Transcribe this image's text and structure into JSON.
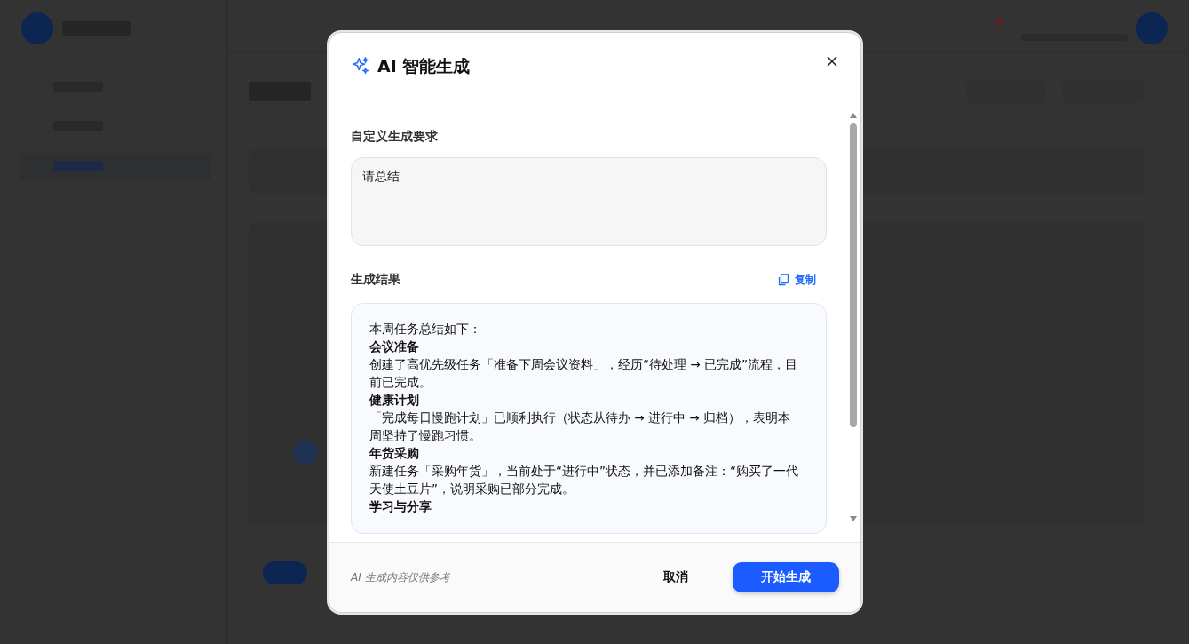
{
  "dialog": {
    "title": "AI 智能生成",
    "prompt": {
      "label": "自定义生成要求",
      "value": "请总结"
    },
    "result": {
      "label": "生成结果",
      "copy_link": "复制",
      "blocks": [
        {
          "kind": "text",
          "text": "本周任务总结如下："
        },
        {
          "kind": "heading",
          "text": "会议准备"
        },
        {
          "kind": "text",
          "text": "创建了高优先级任务「准备下周会议资料」，经历“待处理 → 已完成”流程，目前已完成。"
        },
        {
          "kind": "heading",
          "text": "健康计划"
        },
        {
          "kind": "text",
          "text": "「完成每日慢跑计划」已顺利执行（状态从待办 → 进行中 → 归档），表明本周坚持了慢跑习惯。"
        },
        {
          "kind": "heading",
          "text": "年货采购"
        },
        {
          "kind": "text",
          "text": "新建任务「采购年货」，当前处于“进行中”状态，并已添加备注：“购买了一代天使土豆片”，说明采购已部分完成。"
        },
        {
          "kind": "heading",
          "text": "学习与分享"
        }
      ]
    },
    "footer_note": "AI 生成内容仅供参考",
    "buttons": [
      {
        "label": "取消",
        "kind": "secondary"
      },
      {
        "label": "开始生成",
        "kind": "primary"
      }
    ]
  }
}
